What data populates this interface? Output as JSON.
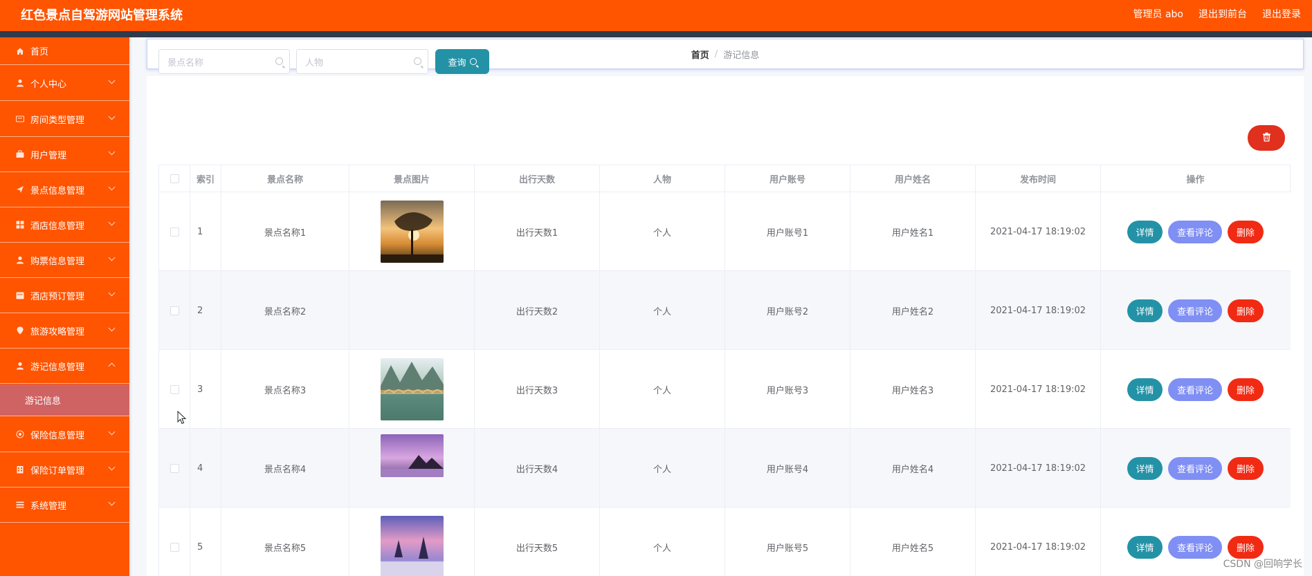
{
  "app": {
    "title": "红色景点自驾游网站管理系统",
    "admin_label": "管理员 abo",
    "to_front": "退出到前台",
    "logout": "退出登录"
  },
  "sidebar": {
    "items": [
      {
        "label": "首页",
        "icon": "home-icon"
      },
      {
        "label": "个人中心",
        "icon": "user-icon"
      },
      {
        "label": "房间类型管理",
        "icon": "card-icon"
      },
      {
        "label": "用户管理",
        "icon": "briefcase-icon"
      },
      {
        "label": "景点信息管理",
        "icon": "send-icon"
      },
      {
        "label": "酒店信息管理",
        "icon": "grid-icon"
      },
      {
        "label": "购票信息管理",
        "icon": "user-icon"
      },
      {
        "label": "酒店预订管理",
        "icon": "calendar-icon"
      },
      {
        "label": "旅游攻略管理",
        "icon": "location-icon"
      },
      {
        "label": "游记信息管理",
        "icon": "user-icon"
      },
      {
        "label": "保险信息管理",
        "icon": "circle-icon"
      },
      {
        "label": "保险订单管理",
        "icon": "building-icon"
      },
      {
        "label": "系统管理",
        "icon": "list-icon"
      }
    ],
    "active_sub": "游记信息"
  },
  "breadcrumb": {
    "home": "首页",
    "sep": "/",
    "current": "游记信息"
  },
  "search": {
    "name_placeholder": "景点名称",
    "person_placeholder": "人物",
    "query_label": "查询"
  },
  "table": {
    "headers": [
      "索引",
      "景点名称",
      "景点图片",
      "出行天数",
      "人物",
      "用户账号",
      "用户姓名",
      "发布时间",
      "操作"
    ],
    "rows": [
      {
        "index": "1",
        "name": "景点名称1",
        "days": "出行天数1",
        "person": "个人",
        "account": "用户账号1",
        "username": "用户姓名1",
        "time": "2021-04-17 18:19:02"
      },
      {
        "index": "2",
        "name": "景点名称2",
        "days": "出行天数2",
        "person": "个人",
        "account": "用户账号2",
        "username": "用户姓名2",
        "time": "2021-04-17 18:19:02"
      },
      {
        "index": "3",
        "name": "景点名称3",
        "days": "出行天数3",
        "person": "个人",
        "account": "用户账号3",
        "username": "用户姓名3",
        "time": "2021-04-17 18:19:02"
      },
      {
        "index": "4",
        "name": "景点名称4",
        "days": "出行天数4",
        "person": "个人",
        "account": "用户账号4",
        "username": "用户姓名4",
        "time": "2021-04-17 18:19:02"
      },
      {
        "index": "5",
        "name": "景点名称5",
        "days": "出行天数5",
        "person": "个人",
        "account": "用户账号5",
        "username": "用户姓名5",
        "time": "2021-04-17 18:19:02"
      }
    ],
    "actions": {
      "detail": "详情",
      "comments": "查看评论",
      "delete": "删除"
    }
  },
  "watermark": "CSDN @回响学长",
  "colors": {
    "brand": "#ff5400",
    "active_sub": "#cf6363",
    "teal": "#2492a6",
    "periwinkle": "#7f8ff4",
    "danger": "#f12a14"
  }
}
